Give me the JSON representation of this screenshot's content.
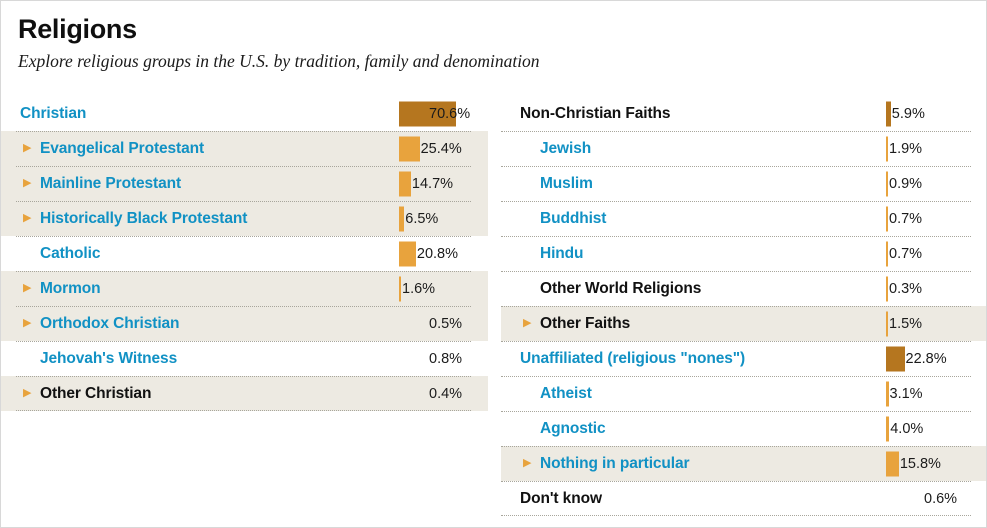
{
  "header": {
    "title": "Religions",
    "subtitle": "Explore religious groups in the U.S. by tradition, family and denomination"
  },
  "colors": {
    "link_blue": "#1191c4",
    "bar_dark": "#b5761f",
    "bar_light": "#e8a33d",
    "row_shaded": "#edeae2",
    "text_black": "#111111",
    "rule": "#a8a69c"
  },
  "icons": {
    "expand": "▶"
  },
  "chart_data": {
    "type": "bar",
    "title": "Religions",
    "subtitle": "Explore religious groups in the U.S. by tradition, family and denomination",
    "xlabel": "",
    "ylabel": "",
    "unit": "percent",
    "value_suffix": "%",
    "xlim": [
      0,
      100
    ],
    "grid": false,
    "legend": "none",
    "orientation": "horizontal",
    "categories": [
      "Christian",
      "Evangelical Protestant",
      "Mainline Protestant",
      "Historically Black Protestant",
      "Catholic",
      "Mormon",
      "Orthodox Christian",
      "Jehovah's Witness",
      "Other Christian",
      "Non-Christian Faiths",
      "Jewish",
      "Muslim",
      "Buddhist",
      "Hindu",
      "Other World Religions",
      "Other Faiths",
      "Unaffiliated (religious \"nones\")",
      "Atheist",
      "Agnostic",
      "Nothing in particular",
      "Don't know"
    ],
    "values": [
      70.6,
      25.4,
      14.7,
      6.5,
      20.8,
      1.6,
      0.5,
      0.8,
      0.4,
      5.9,
      1.9,
      0.9,
      0.7,
      0.7,
      0.3,
      1.5,
      22.8,
      3.1,
      4.0,
      15.8,
      0.6
    ]
  },
  "left_column": {
    "rows": [
      {
        "label": "Christian",
        "value": "70.6%",
        "pct": 70.6,
        "level": "top",
        "style": "blue",
        "triangle": false,
        "shaded": false,
        "bar": "dark",
        "first": true
      },
      {
        "label": "Evangelical Protestant",
        "value": "25.4%",
        "pct": 25.4,
        "level": "sub",
        "style": "blue",
        "triangle": true,
        "shaded": true,
        "bar": "light"
      },
      {
        "label": "Mainline Protestant",
        "value": "14.7%",
        "pct": 14.7,
        "level": "sub",
        "style": "blue",
        "triangle": true,
        "shaded": true,
        "bar": "light"
      },
      {
        "label": "Historically Black Protestant",
        "value": "6.5%",
        "pct": 6.5,
        "level": "sub",
        "style": "blue",
        "triangle": true,
        "shaded": true,
        "bar": "light"
      },
      {
        "label": "Catholic",
        "value": "20.8%",
        "pct": 20.8,
        "level": "sub",
        "style": "blue",
        "triangle": false,
        "shaded": false,
        "bar": "light"
      },
      {
        "label": "Mormon",
        "value": "1.6%",
        "pct": 1.6,
        "level": "sub",
        "style": "blue",
        "triangle": true,
        "shaded": true,
        "bar": "light"
      },
      {
        "label": "Orthodox Christian",
        "value": "0.5%",
        "pct": 0.5,
        "level": "sub",
        "style": "blue",
        "triangle": true,
        "shaded": true,
        "bar": "none"
      },
      {
        "label": "Jehovah's Witness",
        "value": "0.8%",
        "pct": 0.8,
        "level": "sub",
        "style": "blue",
        "triangle": false,
        "shaded": false,
        "bar": "none"
      },
      {
        "label": "Other Christian",
        "value": "0.4%",
        "pct": 0.4,
        "level": "sub",
        "style": "black",
        "triangle": true,
        "shaded": true,
        "bar": "none",
        "last": true
      }
    ]
  },
  "right_column": {
    "rows": [
      {
        "label": "Non-Christian Faiths",
        "value": "5.9%",
        "pct": 5.9,
        "level": "top",
        "style": "black",
        "triangle": false,
        "shaded": false,
        "bar": "dark",
        "first": true
      },
      {
        "label": "Jewish",
        "value": "1.9%",
        "pct": 1.9,
        "level": "sub",
        "style": "blue",
        "triangle": false,
        "shaded": false,
        "bar": "light"
      },
      {
        "label": "Muslim",
        "value": "0.9%",
        "pct": 0.9,
        "level": "sub",
        "style": "blue",
        "triangle": false,
        "shaded": false,
        "bar": "light"
      },
      {
        "label": "Buddhist",
        "value": "0.7%",
        "pct": 0.7,
        "level": "sub",
        "style": "blue",
        "triangle": false,
        "shaded": false,
        "bar": "light"
      },
      {
        "label": "Hindu",
        "value": "0.7%",
        "pct": 0.7,
        "level": "sub",
        "style": "blue",
        "triangle": false,
        "shaded": false,
        "bar": "light"
      },
      {
        "label": "Other World Religions",
        "value": "0.3%",
        "pct": 0.3,
        "level": "sub",
        "style": "black",
        "triangle": false,
        "shaded": false,
        "bar": "light"
      },
      {
        "label": "Other Faiths",
        "value": "1.5%",
        "pct": 1.5,
        "level": "sub",
        "style": "black",
        "triangle": true,
        "shaded": true,
        "bar": "light"
      },
      {
        "label": "Unaffiliated (religious \"nones\")",
        "value": "22.8%",
        "pct": 22.8,
        "level": "top",
        "style": "blue",
        "triangle": false,
        "shaded": false,
        "bar": "dark"
      },
      {
        "label": "Atheist",
        "value": "3.1%",
        "pct": 3.1,
        "level": "sub",
        "style": "blue",
        "triangle": false,
        "shaded": false,
        "bar": "light"
      },
      {
        "label": "Agnostic",
        "value": "4.0%",
        "pct": 4.0,
        "level": "sub",
        "style": "blue",
        "triangle": false,
        "shaded": false,
        "bar": "light"
      },
      {
        "label": "Nothing in particular",
        "value": "15.8%",
        "pct": 15.8,
        "level": "sub",
        "style": "blue",
        "triangle": true,
        "shaded": true,
        "bar": "light"
      },
      {
        "label": "Don't know",
        "value": "0.6%",
        "pct": 0.6,
        "level": "top",
        "style": "black",
        "triangle": false,
        "shaded": false,
        "bar": "none",
        "last": true
      }
    ]
  }
}
